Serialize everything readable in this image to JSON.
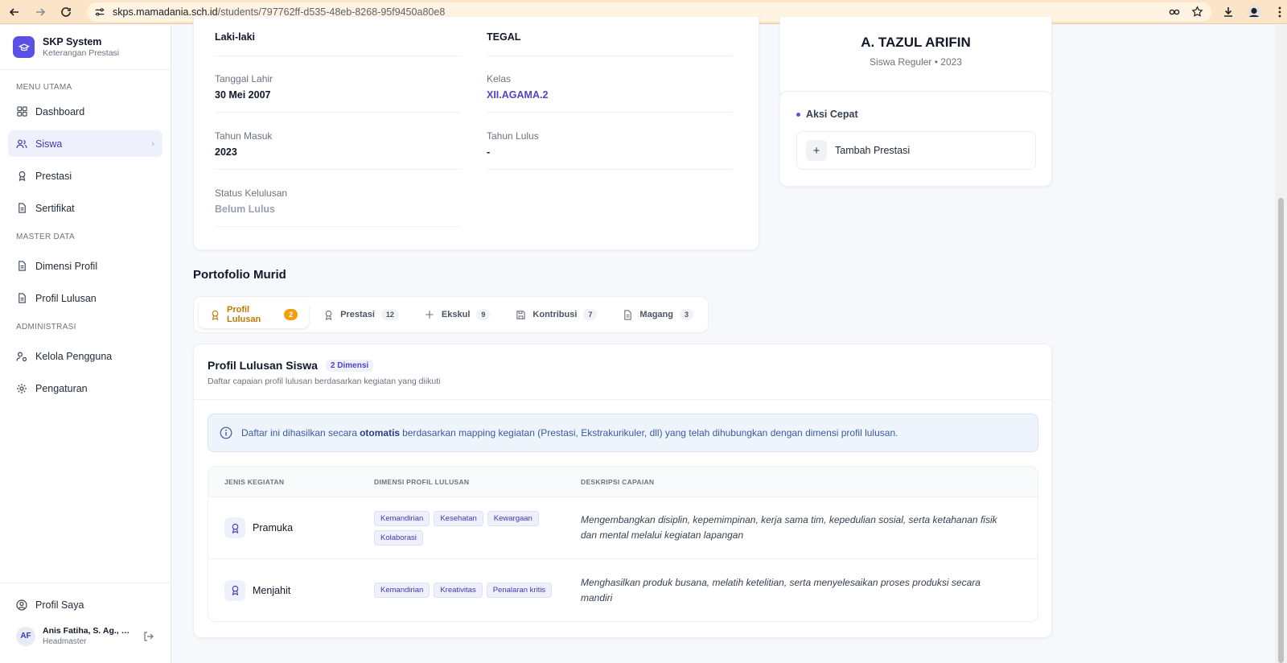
{
  "browser": {
    "url_host": "skps.mamadania.sch.id",
    "url_path": "/students/797762ff-d535-48eb-8268-95f9450a80e8"
  },
  "sidebar": {
    "brand_title": "SKP System",
    "brand_subtitle": "Keterangan Prestasi",
    "section_main": "MENU UTAMA",
    "section_master": "MASTER DATA",
    "section_admin": "ADMINISTRASI",
    "items": [
      {
        "label": "Dashboard"
      },
      {
        "label": "Siswa"
      },
      {
        "label": "Prestasi"
      },
      {
        "label": "Sertifikat"
      },
      {
        "label": "Dimensi Profil"
      },
      {
        "label": "Profil Lulusan"
      },
      {
        "label": "Kelola Pengguna"
      },
      {
        "label": "Pengaturan"
      }
    ],
    "profile_label": "Profil Saya",
    "user_initials": "AF",
    "user_name": "Anis Fatiha, S. Ag., M. ...",
    "user_role": "Headmaster"
  },
  "student": {
    "gender": "Laki-laki",
    "birthplace": "TEGAL",
    "birthdate_label": "Tanggal Lahir",
    "birthdate": "30 Mei 2007",
    "class_label": "Kelas",
    "class": "XII.AGAMA.2",
    "entry_year_label": "Tahun Masuk",
    "entry_year": "2023",
    "grad_year_label": "Tahun Lulus",
    "grad_year": "-",
    "grad_status_label": "Status Kelulusan",
    "grad_status": "Belum Lulus"
  },
  "profile": {
    "name": "A. TAZUL ARIFIN",
    "subtitle": "Siswa Reguler • 2023"
  },
  "quick_actions": {
    "title": "Aksi Cepat",
    "add_label": "Tambah Prestasi"
  },
  "portfolio": {
    "title": "Portofolio Murid",
    "tabs": [
      {
        "label": "Profil Lulusan",
        "count": "2"
      },
      {
        "label": "Prestasi",
        "count": "12"
      },
      {
        "label": "Ekskul",
        "count": "9"
      },
      {
        "label": "Kontribusi",
        "count": "7"
      },
      {
        "label": "Magang",
        "count": "3"
      }
    ]
  },
  "lulusan": {
    "title": "Profil Lulusan Siswa",
    "pill": "2 Dimensi",
    "subtitle": "Daftar capaian profil lulusan berdasarkan kegiatan yang diikuti",
    "info_before": "Daftar ini dihasilkan secara",
    "info_bold": "otomatis",
    "info_after": "berdasarkan mapping kegiatan (Prestasi, Ekstrakurikuler, dll) yang telah dihubungkan dengan dimensi profil lulusan.",
    "columns": [
      "JENIS KEGIATAN",
      "DIMENSI PROFIL LULUSAN",
      "DESKRIPSI CAPAIAN"
    ],
    "rows": [
      {
        "name": "Pramuka",
        "dims": [
          "Kemandirian",
          "Kesehatan",
          "Kewargaan",
          "Kolaborasi"
        ],
        "desc": "Mengembangkan disiplin, kepemimpinan, kerja sama tim, kepedulian sosial, serta ketahanan fisik dan mental melalui kegiatan lapangan"
      },
      {
        "name": "Menjahit",
        "dims": [
          "Kemandirian",
          "Kreativitas",
          "Penalaran kritis"
        ],
        "desc": "Menghasilkan produk busana, melatih ketelitian, serta menyelesaikan proses produksi secara mandiri"
      }
    ]
  }
}
